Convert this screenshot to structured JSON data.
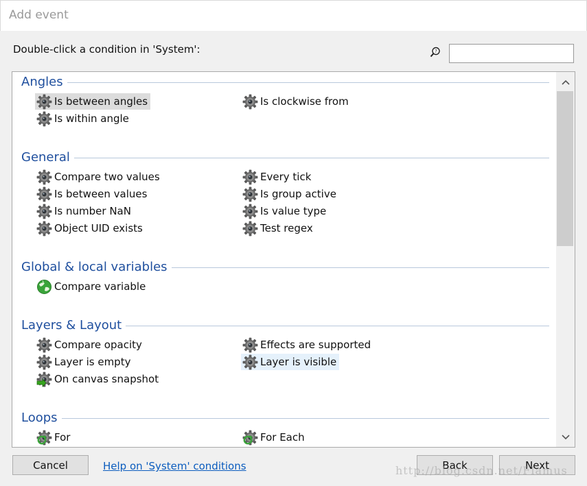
{
  "window": {
    "title": "Add event"
  },
  "instruction": "Double-click a condition in 'System':",
  "search": {
    "value": "",
    "placeholder": ""
  },
  "sections": [
    {
      "title": "Angles",
      "items": [
        {
          "label": "Is between angles",
          "icon": "gear-icon",
          "col": 0,
          "row": 0,
          "state": "selected"
        },
        {
          "label": "Is clockwise from",
          "icon": "gear-icon",
          "col": 1,
          "row": 0
        },
        {
          "label": "Is within angle",
          "icon": "gear-icon",
          "col": 0,
          "row": 1
        }
      ]
    },
    {
      "title": "General",
      "items": [
        {
          "label": "Compare two values",
          "icon": "gear-icon",
          "col": 0,
          "row": 0
        },
        {
          "label": "Every tick",
          "icon": "gear-icon",
          "col": 1,
          "row": 0
        },
        {
          "label": "Is between values",
          "icon": "gear-icon",
          "col": 0,
          "row": 1
        },
        {
          "label": "Is group active",
          "icon": "gear-icon",
          "col": 1,
          "row": 1
        },
        {
          "label": "Is number NaN",
          "icon": "gear-icon",
          "col": 0,
          "row": 2
        },
        {
          "label": "Is value type",
          "icon": "gear-icon",
          "col": 1,
          "row": 2
        },
        {
          "label": "Object UID exists",
          "icon": "gear-icon",
          "col": 0,
          "row": 3
        },
        {
          "label": "Test regex",
          "icon": "gear-icon",
          "col": 1,
          "row": 3
        }
      ]
    },
    {
      "title": "Global & local variables",
      "items": [
        {
          "label": "Compare variable",
          "icon": "globe-icon",
          "col": 0,
          "row": 0
        }
      ]
    },
    {
      "title": "Layers & Layout",
      "items": [
        {
          "label": "Compare opacity",
          "icon": "gear-icon",
          "col": 0,
          "row": 0
        },
        {
          "label": "Effects are supported",
          "icon": "gear-icon",
          "col": 1,
          "row": 0
        },
        {
          "label": "Layer is empty",
          "icon": "gear-icon",
          "col": 0,
          "row": 1
        },
        {
          "label": "Layer is visible",
          "icon": "gear-icon",
          "col": 1,
          "row": 1,
          "state": "hovered"
        },
        {
          "label": "On canvas snapshot",
          "icon": "gear-trigger-icon",
          "col": 0,
          "row": 2
        }
      ]
    },
    {
      "title": "Loops",
      "items": [
        {
          "label": "For",
          "icon": "gear-loop-icon",
          "col": 0,
          "row": 0
        },
        {
          "label": "For Each",
          "icon": "gear-loop-icon",
          "col": 1,
          "row": 0
        }
      ]
    }
  ],
  "buttons": {
    "cancel": "Cancel",
    "back": "Back",
    "next": "Next"
  },
  "help_link": "Help on 'System' conditions",
  "watermark": "http://blog.csdn.net/Flamus",
  "colors": {
    "section_title": "#1f4f9e",
    "link": "#0b5cbe",
    "selected_bg": "#dcdcdc",
    "hover_bg": "#e5f1fb",
    "globe_green": "#3aa43a"
  }
}
